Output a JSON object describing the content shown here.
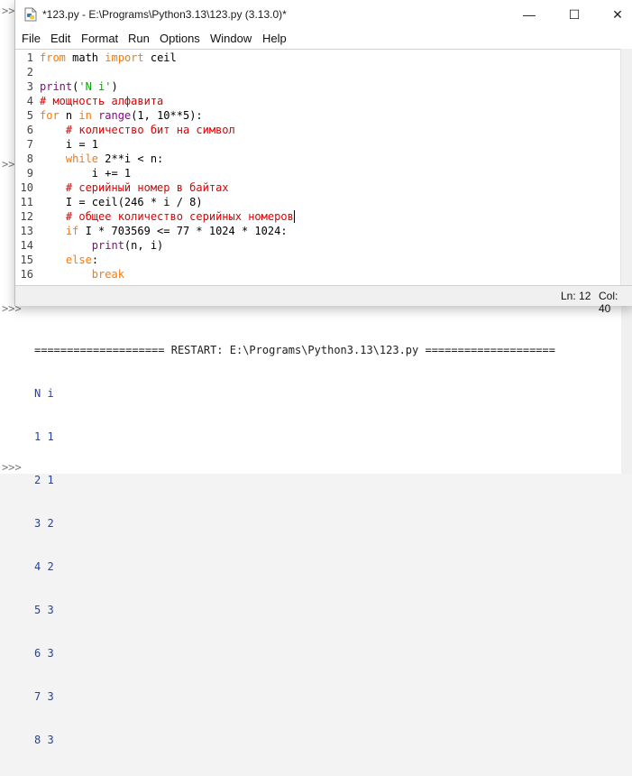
{
  "window": {
    "title": "*123.py - E:\\Programs\\Python3.13\\123.py (3.13.0)*",
    "controls": {
      "minimize": "—",
      "maximize": "☐",
      "close": "✕"
    }
  },
  "menu": [
    "File",
    "Edit",
    "Format",
    "Run",
    "Options",
    "Window",
    "Help"
  ],
  "editor": {
    "line_numbers": [
      "1",
      "2",
      "3",
      "4",
      "5",
      "6",
      "7",
      "8",
      "9",
      "10",
      "11",
      "12",
      "13",
      "14",
      "15",
      "16"
    ],
    "code_lines": [
      "from math import ceil",
      "",
      "print('N i')",
      "# мощность алфавита",
      "for n in range(1, 10**5):",
      "    # количество бит на символ",
      "    i = 1",
      "    while 2**i < n:",
      "        i += 1",
      "    # серийный номер в байтах",
      "    I = ceil(246 * i / 8)",
      "    # общее количество серийных номеров",
      "    if I * 703569 <= 77 * 1024 * 1024:",
      "        print(n, i)",
      "    else:",
      "        break"
    ]
  },
  "status": {
    "line": "Ln: 12",
    "col": "Col: 40"
  },
  "shell": {
    "prompt": ">>>",
    "restart": "==================== RESTART: E:\\Programs\\Python3.13\\123.py ====================",
    "output": [
      "N i",
      "1 1",
      "2 1",
      "3 2",
      "4 2",
      "5 3",
      "6 3",
      "7 3",
      "8 3"
    ]
  },
  "colors": {
    "keyword": "#ff7700",
    "builtin": "#900090",
    "string": "#00aa00",
    "comment": "#dd0000",
    "shell_output": "#1f3fb8"
  },
  "icons": {
    "app": "python-file-icon"
  }
}
